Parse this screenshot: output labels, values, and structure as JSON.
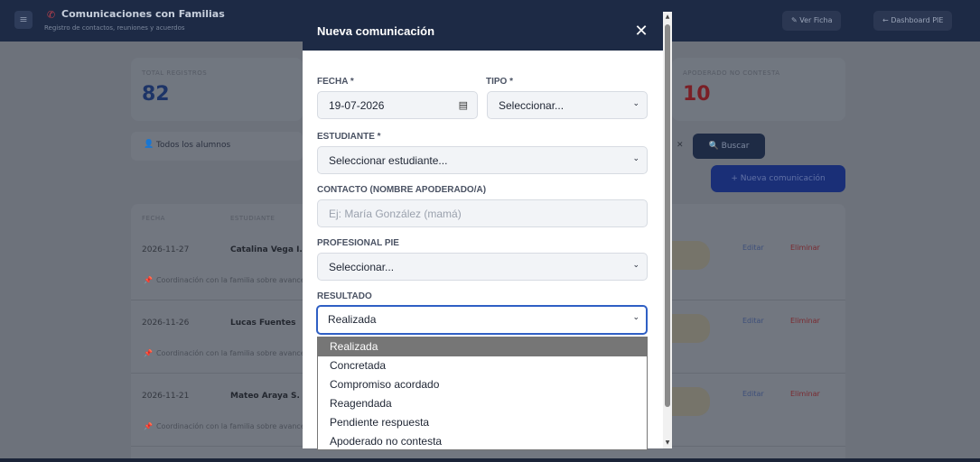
{
  "topbar": {
    "logo": "≡",
    "phone_icon": "phone-icon",
    "title": "Comunicaciones con Familias",
    "subtitle": "Registro de contactos, reuniones y acuerdos",
    "button_1": "✎ Ver Ficha",
    "button_2": "← Dashboard PIE"
  },
  "stats": {
    "left_label": "TOTAL REGISTROS",
    "left_value": "82",
    "right_label": "APODERADO NO CONTESTA",
    "right_value": "10"
  },
  "filters": {
    "student_icon": "person-icon",
    "student_filter": "Todos los alumnos",
    "clear_icon": "✕",
    "search_button": "🔍 Buscar",
    "new_button": "+ Nueva comunicación"
  },
  "table": {
    "headers": [
      "FECHA",
      "ESTUDIANTE"
    ],
    "rows": [
      {
        "date": "2026-11-27",
        "student": "Catalina Vega I.",
        "note": "Coordinación con la familia sobre avances",
        "edit": "Editar",
        "delete": "Eliminar"
      },
      {
        "date": "2026-11-26",
        "student": "Lucas Fuentes",
        "note": "Coordinación con la familia sobre avances",
        "edit": "Editar",
        "delete": "Eliminar"
      },
      {
        "date": "2026-11-21",
        "student": "Mateo Araya S.",
        "note": "Coordinación con la familia sobre avances",
        "edit": "Editar",
        "delete": "Eliminar"
      }
    ]
  },
  "modal": {
    "title": "Nueva comunicación",
    "close_icon": "✕",
    "fecha_label": "FECHA *",
    "fecha_value": "19-07-2026",
    "calendar_icon": "📅",
    "tipo_label": "TIPO *",
    "tipo_value": "Seleccionar...",
    "estudiante_label": "ESTUDIANTE *",
    "estudiante_value": "Seleccionar estudiante...",
    "contacto_label": "CONTACTO (NOMBRE APODERADO/A)",
    "contacto_placeholder": "Ej: María González (mamá)",
    "profesional_label": "PROFESIONAL PIE",
    "profesional_value": "Seleccionar...",
    "resultado_label": "RESULTADO",
    "resultado_value": "Realizada",
    "chevron": "❯"
  },
  "resultado_options": [
    "Realizada",
    "Concretada",
    "Compromiso acordado",
    "Reagendada",
    "Pendiente respuesta",
    "Apoderado no contesta"
  ],
  "scrollbar": {
    "up": "▲",
    "down": "▼"
  }
}
